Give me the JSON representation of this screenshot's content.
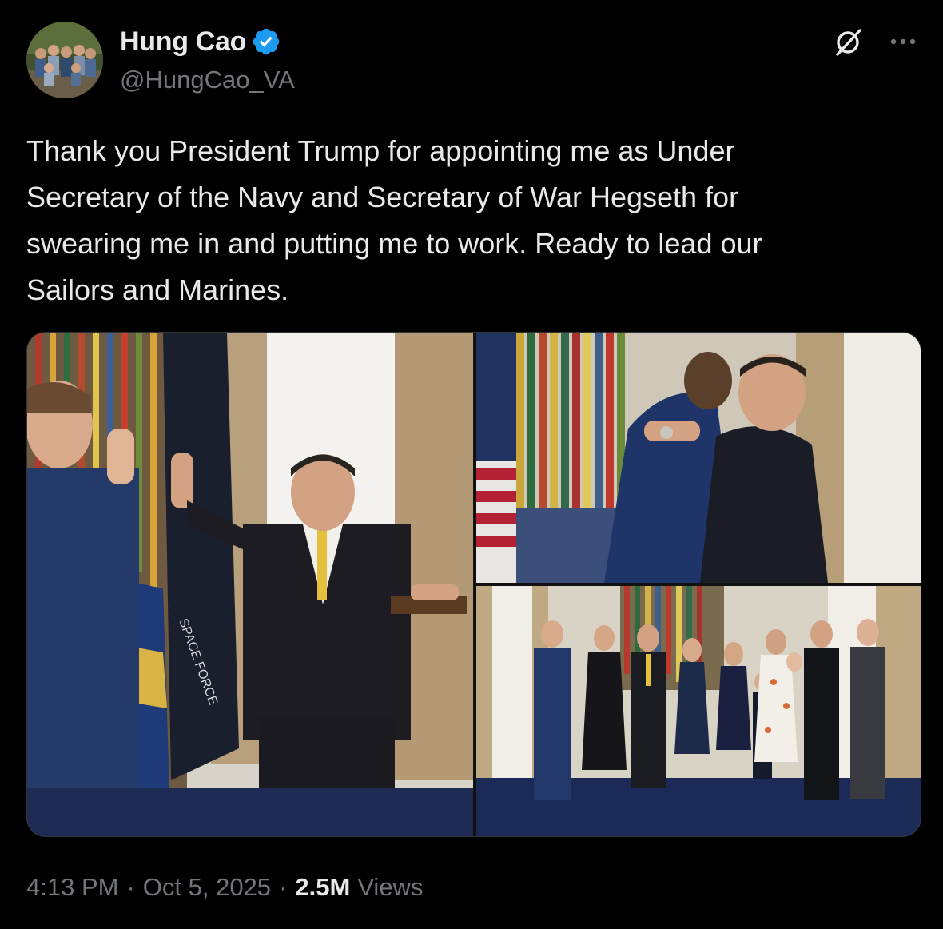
{
  "author": {
    "display_name": "Hung Cao",
    "handle": "@HungCao_VA",
    "verified": true,
    "verified_color": "#1d9bf0"
  },
  "tweet": {
    "text": "Thank you President Trump for appointing me as Under\nSecretary of the Navy and Secretary of War Hegseth for\nswearing me in and putting me to work. Ready to lead our\nSailors and Marines."
  },
  "media": {
    "photos": [
      {
        "subject": "swearing-in-photo",
        "flag_text": "SPACE FORCE"
      },
      {
        "subject": "embrace-photo"
      },
      {
        "subject": "family-group-photo"
      }
    ]
  },
  "footer": {
    "time": "4:13 PM",
    "separator": "·",
    "date": "Oct 5, 2025",
    "views_count": "2.5M",
    "views_label": "Views"
  },
  "icons": {
    "grok": "grok-icon",
    "more": "more-icon",
    "verified": "verified-badge-icon"
  },
  "colors": {
    "background": "#000000",
    "primary_text": "#e7e9ea",
    "secondary_text": "#71767b"
  }
}
